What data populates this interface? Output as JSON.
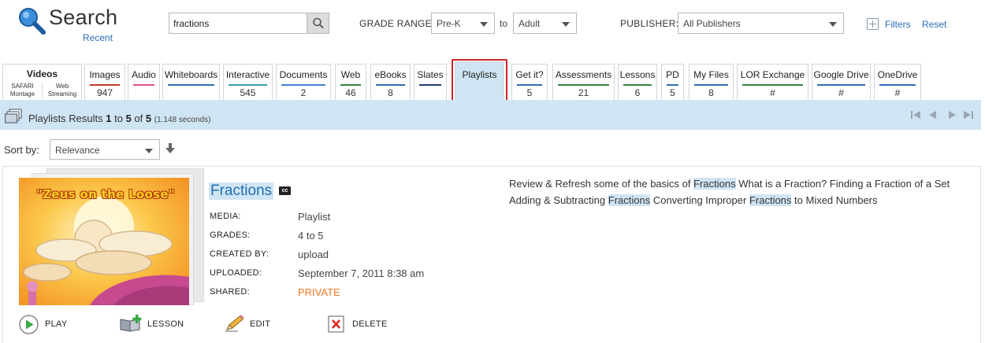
{
  "header": {
    "title": "Search",
    "recent_label": "Recent",
    "search_value": "fractions",
    "grade_range_label": "GRADE RANGE:",
    "grade_from": "Pre-K",
    "to_label": "to",
    "grade_to": "Adult",
    "publisher_label": "PUBLISHER:",
    "publisher_value": "All Publishers",
    "filters_label": "Filters",
    "reset_label": "Reset"
  },
  "videos_tab": {
    "title": "Videos",
    "sub_left": "SAFARI Montage",
    "sub_right": "Web Streaming"
  },
  "tabs": [
    {
      "label": "Images",
      "count": "947",
      "color": "#c0392b"
    },
    {
      "label": "Audio",
      "count": "",
      "color": "#d94f8a"
    },
    {
      "label": "Whiteboards",
      "count": "",
      "color": "#2f6db1"
    },
    {
      "label": "Interactive",
      "count": "545",
      "color": "#3aa0a5"
    },
    {
      "label": "Documents",
      "count": "2",
      "color": "#3d7fd1"
    },
    {
      "label": "Web",
      "count": "46",
      "color": "#2f8a3f"
    },
    {
      "label": "eBooks",
      "count": "8",
      "color": "#2f6db1"
    },
    {
      "label": "Slates",
      "count": "",
      "color": "#243a6e"
    },
    {
      "label": "Playlists",
      "count": "",
      "color": "#d0e5f3"
    },
    {
      "label": "Get it?",
      "count": "5",
      "color": "#2f6db1"
    },
    {
      "label": "Assessments",
      "count": "21",
      "color": "#2f8a3f"
    },
    {
      "label": "Lessons",
      "count": "6",
      "color": "#2f8a3f"
    },
    {
      "label": "PD",
      "count": "5",
      "color": "#2f6db1"
    },
    {
      "label": "My Files",
      "count": "8",
      "color": "#2f6db1"
    },
    {
      "label": "LOR Exchange",
      "count": "#",
      "color": "#2f8a3f"
    },
    {
      "label": "Google Drive",
      "count": "#",
      "color": "#2f6db1"
    },
    {
      "label": "OneDrive",
      "count": "#",
      "color": "#2f6db1"
    }
  ],
  "results": {
    "prefix": "Playlists Results ",
    "from": "1",
    "to_word": " to ",
    "to": "5",
    "of_word": " of ",
    "total": "5",
    "seconds": "(1.148 seconds)"
  },
  "sort": {
    "label": "Sort by:",
    "value": "Relevance"
  },
  "item": {
    "title": "Fractions",
    "cc": "cc",
    "thumb_text": "\"Zeus on the Loose\"",
    "meta": [
      {
        "label": "MEDIA:",
        "value": "Playlist"
      },
      {
        "label": "GRADES:",
        "value": "4 to 5"
      },
      {
        "label": "CREATED BY:",
        "value": "upload"
      },
      {
        "label": "UPLOADED:",
        "value": "September 7, 2011 8:38 am"
      },
      {
        "label": "SHARED:",
        "value": "PRIVATE"
      }
    ],
    "description": {
      "p1": "Review & Refresh some of the basics of ",
      "h1": "Fractions",
      "p2": " What is a Fraction? Finding a Fraction of a Set Adding & Subtracting ",
      "h2": "Fractions",
      "p3": " Converting Improper ",
      "h3": "Fractions",
      "p4": " to Mixed Numbers"
    },
    "actions": {
      "play": "PLAY",
      "lesson": "LESSON",
      "edit": "EDIT",
      "delete": "DELETE"
    }
  },
  "colors": {
    "accent": "#2a6cb5",
    "highlight": "#d0e5f3",
    "active_outline": "#cc2229",
    "private": "#f07a22"
  }
}
